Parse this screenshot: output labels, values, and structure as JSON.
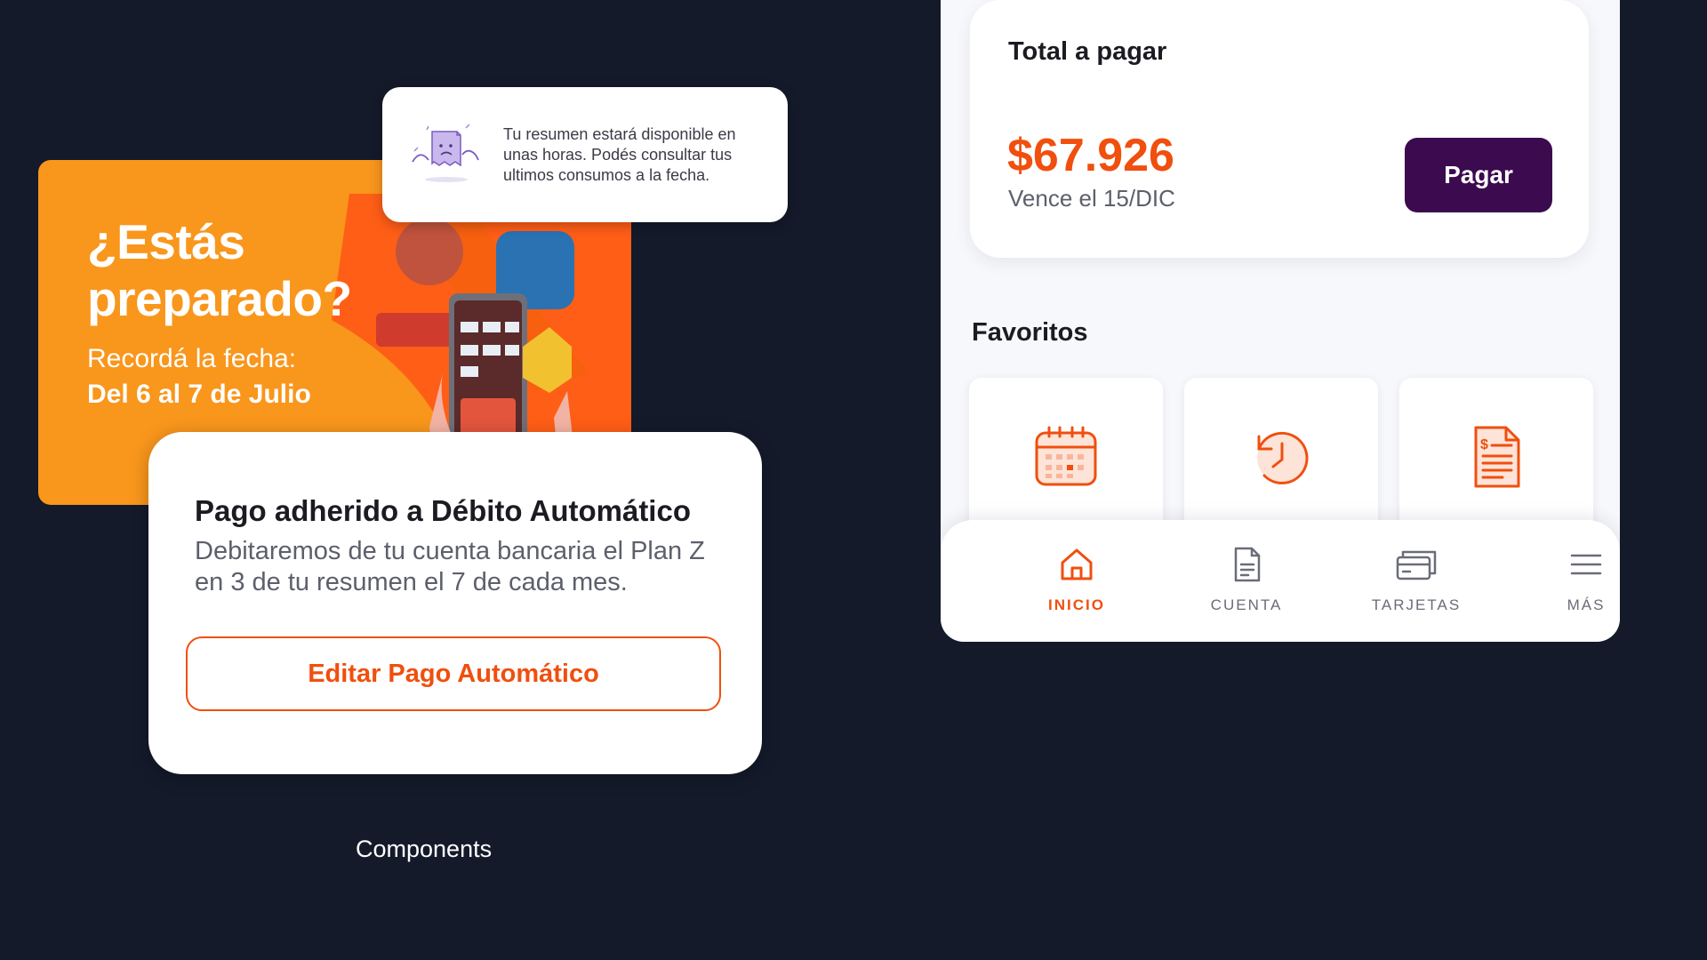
{
  "promo": {
    "title": "¿Estás preparado?",
    "subtitle": "Recordá la fecha:",
    "date": "Del 6 al 7 de Julio"
  },
  "toast": {
    "message": "Tu resumen estará disponible en unas horas. Podés consultar tus ultimos consumos a la fecha."
  },
  "debit_card": {
    "title": "Pago adherido a Débito Automático",
    "body": "Debitaremos de tu cuenta bancaria el Plan Z en 3 de tu resumen el 7 de cada mes.",
    "edit_label": "Editar Pago Automático"
  },
  "caption": "Components",
  "payment": {
    "label": "Total a pagar",
    "amount": "$67.926",
    "due": "Vence el 15/DIC",
    "pay_label": "Pagar"
  },
  "favorites": {
    "title": "Favoritos",
    "items": [
      {
        "icon": "calendar-icon"
      },
      {
        "icon": "history-clock-icon"
      },
      {
        "icon": "invoice-document-icon"
      }
    ]
  },
  "tabbar": {
    "tabs": [
      {
        "label": "INICIO",
        "icon": "home-icon",
        "active": true
      },
      {
        "label": "CUENTA",
        "icon": "document-icon",
        "active": false
      },
      {
        "label": "TARJETAS",
        "icon": "cards-icon",
        "active": false
      },
      {
        "label": "MÁS",
        "icon": "menu-icon",
        "active": false
      }
    ]
  },
  "colors": {
    "background": "#141a2a",
    "accent_orange": "#f04f0e",
    "promo_orange": "#f9961c",
    "pay_button": "#3c0a4e"
  }
}
